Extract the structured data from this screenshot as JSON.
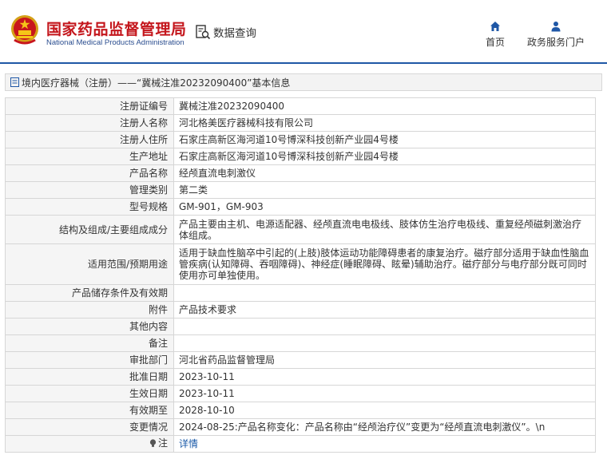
{
  "header": {
    "logo_cn": "国家药品监督管理局",
    "logo_en": "National Medical Products Administration",
    "search_label": "数据查询",
    "nav": {
      "home": "首页",
      "service": "政务服务门户"
    }
  },
  "breadcrumb": {
    "text": "境内医疗器械（注册）——“冀械注准20232090400”基本信息"
  },
  "record": {
    "rows": [
      {
        "label": "注册证编号",
        "value": "冀械注准20232090400"
      },
      {
        "label": "注册人名称",
        "value": "河北格美医疗器械科技有限公司"
      },
      {
        "label": "注册人住所",
        "value": "石家庄高新区海河道10号博深科技创新产业园4号楼"
      },
      {
        "label": "生产地址",
        "value": "石家庄高新区海河道10号博深科技创新产业园4号楼"
      },
      {
        "label": "产品名称",
        "value": "经颅直流电刺激仪"
      },
      {
        "label": "管理类别",
        "value": "第二类"
      },
      {
        "label": "型号规格",
        "value": "GM-901，GM-903"
      },
      {
        "label": "结构及组成/主要组成成分",
        "value": "产品主要由主机、电源适配器、经颅直流电电极线、肢体仿生治疗电极线、重复经颅磁刺激治疗体组成。"
      },
      {
        "label": "适用范围/预期用途",
        "value": "适用于缺血性脑卒中引起的(上肢)肢体运动功能障碍患者的康复治疗。磁疗部分适用于缺血性脑血管疾病(认知障碍、吞咽障碍)、神经症(睡眠障碍、眩晕)辅助治疗。磁疗部分与电疗部分既可同时使用亦可单独使用。"
      },
      {
        "label": "产品储存条件及有效期",
        "value": ""
      },
      {
        "label": "附件",
        "value": "产品技术要求"
      },
      {
        "label": "其他内容",
        "value": ""
      },
      {
        "label": "备注",
        "value": ""
      },
      {
        "label": "审批部门",
        "value": "河北省药品监督管理局"
      },
      {
        "label": "批准日期",
        "value": "2023-10-11"
      },
      {
        "label": "生效日期",
        "value": "2023-10-11"
      },
      {
        "label": "有效期至",
        "value": "2028-10-10"
      },
      {
        "label": "变更情况",
        "value": "2024-08-25:产品名称变化：产品名称由“经颅治疗仪”变更为“经颅直流电刺激仪”。\\n"
      }
    ],
    "note_label": "注",
    "note_link": "详情"
  }
}
